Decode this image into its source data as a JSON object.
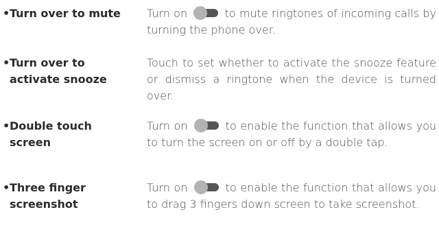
{
  "items": [
    {
      "term": [
        "Turn over to mute"
      ],
      "desc_before": "Turn on",
      "has_toggle": true,
      "toggle_icon": "toggle-switch-icon",
      "desc_after": "to mute ringtones of incoming calls by turning the phone over."
    },
    {
      "term": [
        "Turn over to",
        "activate snooze"
      ],
      "desc_before": "Touch to set whether to activate the snooze feature or dismiss a ringtone when the device is turned over.",
      "has_toggle": false,
      "desc_after": ""
    },
    {
      "term": [
        "Double touch",
        "screen"
      ],
      "desc_before": "Turn on",
      "has_toggle": true,
      "toggle_icon": "toggle-switch-icon",
      "desc_after": "to enable the function that allows you to turn the screen on or off by a double tap."
    },
    {
      "term": [
        "Three finger",
        "screenshot"
      ],
      "desc_before": "Turn on",
      "has_toggle": true,
      "toggle_icon": "toggle-switch-icon",
      "desc_after": "to enable the function that allows you to drag 3 fingers down screen to take screenshot."
    }
  ],
  "colors": {
    "term_text": "#2b2b2b",
    "desc_text": "#4a4a4a",
    "toggle_track": "#555555",
    "toggle_knob": "#b3b3b3"
  },
  "bullet": "•"
}
